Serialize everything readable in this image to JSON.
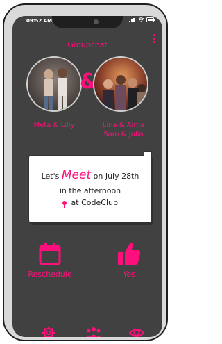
{
  "status": {
    "time": "09:52 AM"
  },
  "header": {
    "title": "Groupchat"
  },
  "group_a": {
    "name": "Meta & Lilly"
  },
  "group_b": {
    "line1": "Lina & Alma",
    "line2": "Sam & Julia"
  },
  "connector": "&",
  "invite": {
    "lets": "Let's",
    "meet": "Meet",
    "when": "on July 28th",
    "line2": "in the afternoon",
    "location": "at CodeClub"
  },
  "actions": {
    "reschedule": "Reschedule",
    "yes": "Yes"
  },
  "colors": {
    "accent": "#ff0f7b",
    "background": "#414141",
    "card": "#ffffff"
  },
  "nav": {
    "icons": [
      "gear-icon",
      "group-icon",
      "eye-icon"
    ]
  }
}
